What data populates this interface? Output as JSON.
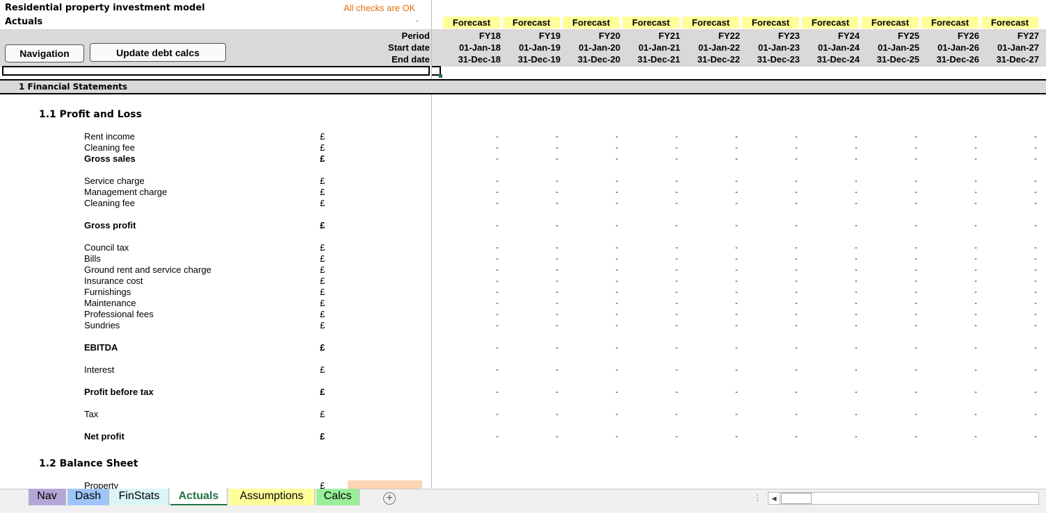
{
  "header": {
    "title": "Residential property investment model",
    "sheet_name": "Actuals",
    "checks_status": "All checks are OK",
    "checks_dash": "-",
    "row_labels": {
      "period": "Period",
      "start": "Start date",
      "end": "End date"
    }
  },
  "buttons": {
    "navigation": "Navigation",
    "update_debt": "Update debt calcs"
  },
  "columns": [
    {
      "type": "Forecast",
      "period": "FY18",
      "start": "01-Jan-18",
      "end": "31-Dec-18"
    },
    {
      "type": "Forecast",
      "period": "FY19",
      "start": "01-Jan-19",
      "end": "31-Dec-19"
    },
    {
      "type": "Forecast",
      "period": "FY20",
      "start": "01-Jan-20",
      "end": "31-Dec-20"
    },
    {
      "type": "Forecast",
      "period": "FY21",
      "start": "01-Jan-21",
      "end": "31-Dec-21"
    },
    {
      "type": "Forecast",
      "period": "FY22",
      "start": "01-Jan-22",
      "end": "31-Dec-22"
    },
    {
      "type": "Forecast",
      "period": "FY23",
      "start": "01-Jan-23",
      "end": "31-Dec-23"
    },
    {
      "type": "Forecast",
      "period": "FY24",
      "start": "01-Jan-24",
      "end": "31-Dec-24"
    },
    {
      "type": "Forecast",
      "period": "FY25",
      "start": "01-Jan-25",
      "end": "31-Dec-25"
    },
    {
      "type": "Forecast",
      "period": "FY26",
      "start": "01-Jan-26",
      "end": "31-Dec-26"
    },
    {
      "type": "Forecast",
      "period": "FY27",
      "start": "01-Jan-27",
      "end": "31-Dec-27"
    }
  ],
  "section": {
    "title": "1 Financial Statements"
  },
  "pnl": {
    "title": "1.1  Profit and Loss",
    "rows": [
      {
        "label": "Rent income",
        "unit": "£",
        "bold": false,
        "value": "-"
      },
      {
        "label": "Cleaning fee",
        "unit": "£",
        "bold": false,
        "value": "-"
      },
      {
        "label": "Gross sales",
        "unit": "£",
        "bold": true,
        "value": "-"
      },
      {
        "label": "Service charge",
        "unit": "£",
        "bold": false,
        "value": "-"
      },
      {
        "label": "Management charge",
        "unit": "£",
        "bold": false,
        "value": "-"
      },
      {
        "label": "Cleaning fee",
        "unit": "£",
        "bold": false,
        "value": "-"
      },
      {
        "label": "Gross profit",
        "unit": "£",
        "bold": true,
        "value": "-"
      },
      {
        "label": "Council tax",
        "unit": "£",
        "bold": false,
        "value": "-"
      },
      {
        "label": "Bills",
        "unit": "£",
        "bold": false,
        "value": "-"
      },
      {
        "label": "Ground rent and service charge",
        "unit": "£",
        "bold": false,
        "value": "-"
      },
      {
        "label": "Insurance cost",
        "unit": "£",
        "bold": false,
        "value": "-"
      },
      {
        "label": "Furnishings",
        "unit": "£",
        "bold": false,
        "value": "-"
      },
      {
        "label": "Maintenance",
        "unit": "£",
        "bold": false,
        "value": "-"
      },
      {
        "label": "Professional fees",
        "unit": "£",
        "bold": false,
        "value": "-"
      },
      {
        "label": "Sundries",
        "unit": "£",
        "bold": false,
        "value": "-"
      },
      {
        "label": "EBITDA",
        "unit": "£",
        "bold": true,
        "value": "-"
      },
      {
        "label": "Interest",
        "unit": "£",
        "bold": false,
        "value": "-"
      },
      {
        "label": "Profit before tax",
        "unit": "£",
        "bold": true,
        "value": "-"
      },
      {
        "label": "Tax",
        "unit": "£",
        "bold": false,
        "value": "-"
      },
      {
        "label": "Net profit",
        "unit": "£",
        "bold": true,
        "value": "-"
      }
    ]
  },
  "balance_sheet": {
    "title": "1.2  Balance Sheet",
    "rows": [
      {
        "label": "Property",
        "unit": "£",
        "bold": false
      }
    ]
  },
  "tabs": [
    {
      "label": "Nav",
      "color": "#b4a7d6",
      "active": false
    },
    {
      "label": "Dash",
      "color": "#9fc5f8",
      "active": false
    },
    {
      "label": "FinStats",
      "color": "#d9f5f5",
      "active": false
    },
    {
      "label": "Actuals",
      "color": "#ffffff",
      "active": true
    },
    {
      "label": "Assumptions",
      "color": "#ffff99",
      "active": false
    },
    {
      "label": "Calcs",
      "color": "#99ee99",
      "active": false
    }
  ],
  "colors": {
    "forecast_bg": "#ffff99",
    "checks_text": "#e46c0a",
    "active_tab": "#217346",
    "input_cell": "#fcd5b4"
  }
}
